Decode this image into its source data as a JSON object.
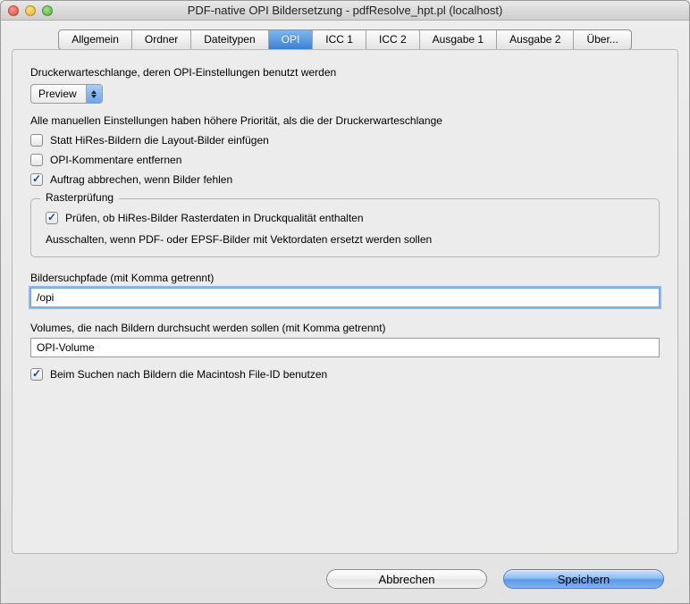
{
  "title": "PDF-native OPI Bildersetzung - pdfResolve_hpt.pl (localhost)",
  "tabs": [
    "Allgemein",
    "Ordner",
    "Dateitypen",
    "OPI",
    "ICC 1",
    "ICC 2",
    "Ausgabe 1",
    "Ausgabe 2",
    "Über..."
  ],
  "activeTab": 3,
  "labels": {
    "queue": "Druckerwarteschlange, deren OPI-Einstellungen benutzt werden",
    "priorityNote": "Alle manuellen Einstellungen haben höhere Priorität, als die der Druckerwarteschlange",
    "opt_layout": "Statt HiRes-Bildern die Layout-Bilder einfügen",
    "opt_removeOPI": "OPI-Kommentare entfernen",
    "opt_abort": "Auftrag abbrechen, wenn Bilder fehlen",
    "group_raster": "Rasterprüfung",
    "opt_checkRaster": "Prüfen, ob HiRes-Bilder Rasterdaten in Druckqualität enthalten",
    "rasterNote": "Ausschalten, wenn PDF- oder EPSF-Bilder mit Vektordaten ersetzt werden sollen",
    "field_paths": "Bildersuchpfade (mit Komma getrennt)",
    "field_volumes": "Volumes, die nach Bildern durchsucht werden sollen (mit Komma getrennt)",
    "opt_fileID": "Beim Suchen nach Bildern die Macintosh File-ID benutzen"
  },
  "values": {
    "queuePopup": "Preview",
    "paths": "/opi",
    "volumes": "OPI-Volume"
  },
  "checkboxes": {
    "layout": false,
    "removeOPI": false,
    "abort": true,
    "checkRaster": true,
    "fileID": true
  },
  "buttons": {
    "cancel": "Abbrechen",
    "save": "Speichern"
  }
}
